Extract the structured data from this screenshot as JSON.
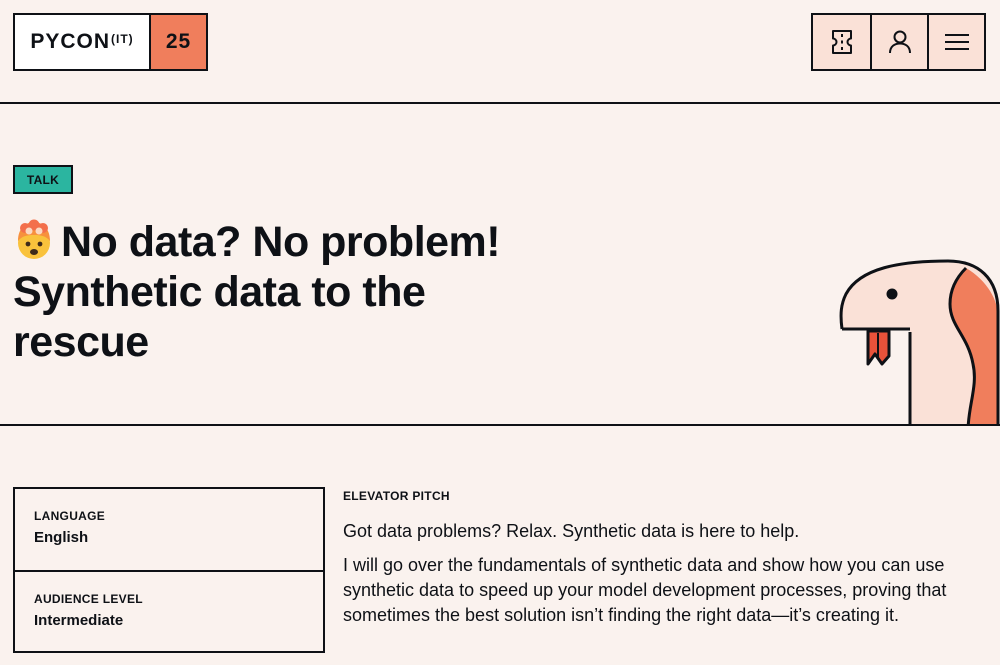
{
  "header": {
    "logo_main": "PYCON",
    "logo_sup": "(IT)",
    "logo_year": "25",
    "nav": [
      {
        "icon": "ticket-icon"
      },
      {
        "icon": "user-icon"
      },
      {
        "icon": "menu-icon"
      }
    ]
  },
  "talk": {
    "tag": "TALK",
    "emoji": "exploding-head-icon",
    "title_lines": [
      "No data? No problem!",
      "Synthetic data to the",
      "rescue"
    ]
  },
  "details": [
    {
      "label": "LANGUAGE",
      "value": "English"
    },
    {
      "label": "AUDIENCE LEVEL",
      "value": "Intermediate"
    }
  ],
  "pitch": {
    "label": "ELEVATOR PITCH",
    "lead": "Got data problems? Relax. Synthetic data is here to help.",
    "body": "I will go over the fundamentals of synthetic data and show how you can use synthetic data to speed up your model development processes, proving that sometimes the best solution isn’t finding the right data—it’s creating it."
  },
  "colors": {
    "background": "#FAF2EE",
    "accent_orange": "#F07E5C",
    "tag_teal": "#2BB5A0",
    "nav_bg": "#FAE1D7",
    "ink": "#0E1116"
  }
}
